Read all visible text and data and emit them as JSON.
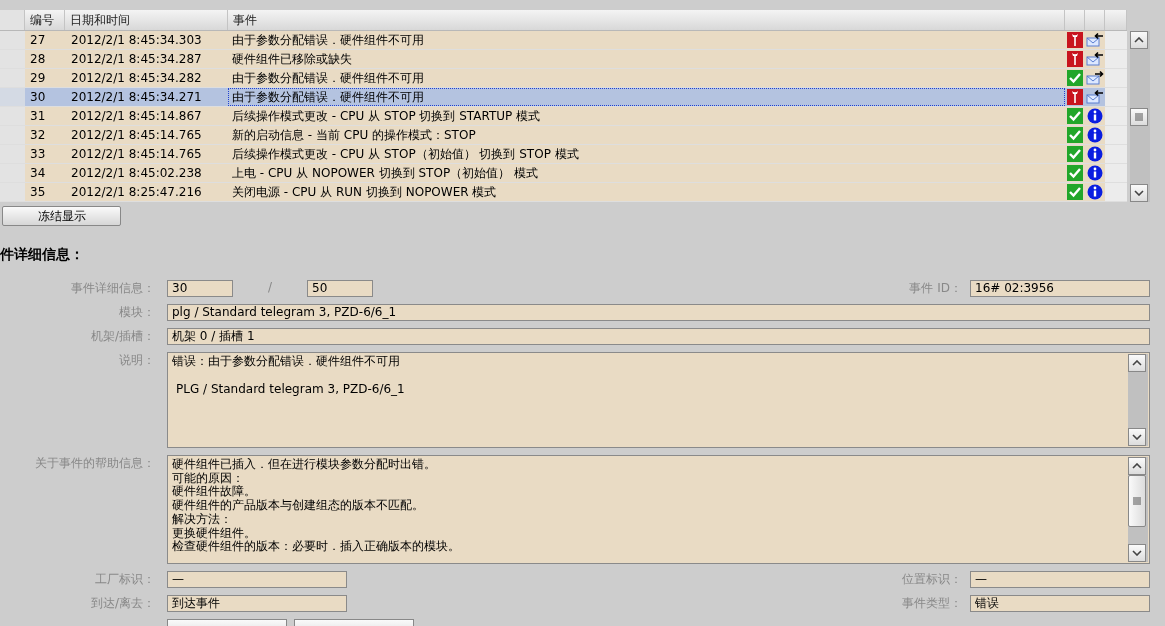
{
  "table": {
    "columns": [
      "编号",
      "日期和时间",
      "事件"
    ],
    "rows": [
      {
        "no": "27",
        "time": "2012/2/1 8:45:34.303",
        "event": "由于参数分配错误．硬件组件不可用",
        "icons": [
          {
            "kind": "error"
          },
          {
            "kind": "incoming"
          }
        ],
        "selected": false
      },
      {
        "no": "28",
        "time": "2012/2/1 8:45:34.287",
        "event": "硬件组件已移除或缺失",
        "icons": [
          {
            "kind": "error"
          },
          {
            "kind": "incoming"
          }
        ],
        "selected": false
      },
      {
        "no": "29",
        "time": "2012/2/1 8:45:34.282",
        "event": "由于参数分配错误．硬件组件不可用",
        "icons": [
          {
            "kind": "ok"
          },
          {
            "kind": "outgoing"
          }
        ],
        "selected": false
      },
      {
        "no": "30",
        "time": "2012/2/1 8:45:34.271",
        "event": "由于参数分配错误．硬件组件不可用",
        "icons": [
          {
            "kind": "error"
          },
          {
            "kind": "incoming"
          }
        ],
        "selected": true
      },
      {
        "no": "31",
        "time": "2012/2/1 8:45:14.867",
        "event": "后续操作模式更改 - CPU 从 STOP 切换到 STARTUP 模式",
        "icons": [
          {
            "kind": "ok"
          },
          {
            "kind": "info"
          }
        ],
        "selected": false
      },
      {
        "no": "32",
        "time": "2012/2/1 8:45:14.765",
        "event": "新的启动信息 - 当前 CPU 的操作模式：STOP",
        "icons": [
          {
            "kind": "ok"
          },
          {
            "kind": "info"
          }
        ],
        "selected": false
      },
      {
        "no": "33",
        "time": "2012/2/1 8:45:14.765",
        "event": "后续操作模式更改 - CPU 从 STOP（初始值） 切换到 STOP 模式",
        "icons": [
          {
            "kind": "ok"
          },
          {
            "kind": "info"
          }
        ],
        "selected": false
      },
      {
        "no": "34",
        "time": "2012/2/1 8:45:02.238",
        "event": "上电 - CPU 从 NOPOWER 切换到 STOP（初始值） 模式",
        "icons": [
          {
            "kind": "ok"
          },
          {
            "kind": "info"
          }
        ],
        "selected": false
      },
      {
        "no": "35",
        "time": "2012/2/1 8:25:47.216",
        "event": "关闭电源 - CPU 从 RUN 切换到 NOPOWER 模式",
        "icons": [
          {
            "kind": "ok"
          },
          {
            "kind": "info"
          }
        ],
        "selected": false
      }
    ]
  },
  "freeze_button": "冻结显示",
  "details": {
    "heading": "件详细信息：",
    "event_detail": {
      "label": "事件详细信息：",
      "current": "30",
      "separator": "/",
      "total": "50"
    },
    "event_id": {
      "label": "事件 ID：",
      "value": "16# 02:3956"
    },
    "module": {
      "label": "模块：",
      "value": "plg / Standard telegram 3, PZD-6/6_1"
    },
    "rack_slot": {
      "label": "机架/插槽：",
      "value": "机架 0 / 插槽 1"
    },
    "description": {
      "label": "说明：",
      "lines": [
        "错误：由于参数分配错误．硬件组件不可用",
        "PLG / Standard telegram 3, PZD-6/6_1"
      ]
    },
    "help": {
      "label": "关于事件的帮助信息：",
      "lines": [
        "硬件组件已插入．但在进行模块参数分配时出错。",
        "可能的原因：",
        "硬件组件故障。",
        "硬件组件的产品版本与创建组态的版本不匹配。",
        "解决方法：",
        "更换硬件组件。",
        "检查硬件组件的版本：必要时．插入正确版本的模块。"
      ]
    },
    "plant_id": {
      "label": "工厂标识：",
      "value": "—"
    },
    "location_id": {
      "label": "位置标识：",
      "value": "—"
    },
    "arrive_leave": {
      "label": "到达/离去：",
      "value": "到达事件"
    },
    "event_type": {
      "label": "事件类型：",
      "value": "错误"
    }
  }
}
